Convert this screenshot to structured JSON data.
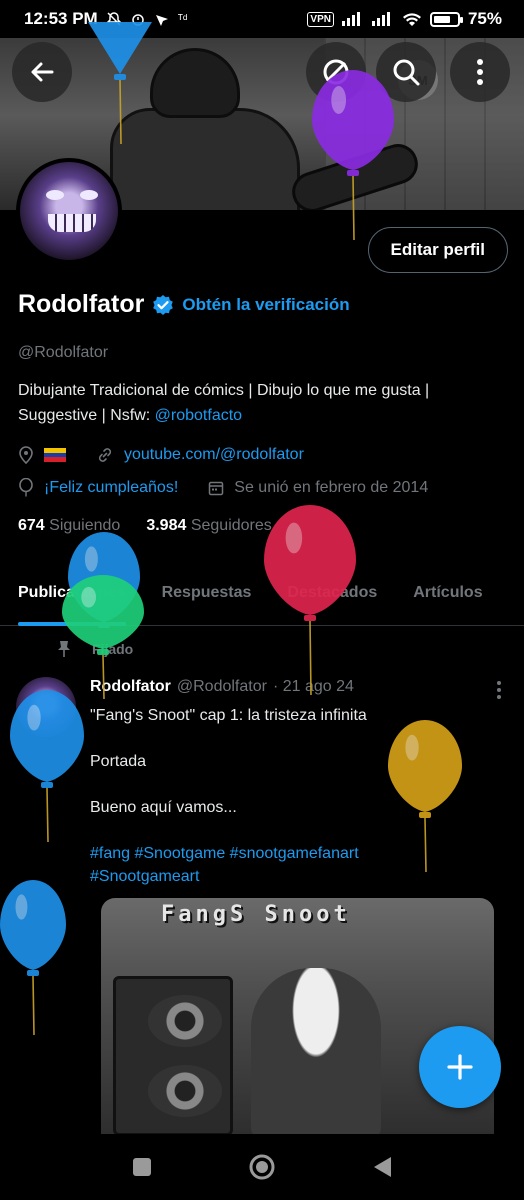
{
  "status_bar": {
    "time": "12:53 PM",
    "left_extra": "ᵀᵈ",
    "vpn": "VPN",
    "battery": "75%",
    "battery_level": 0.75
  },
  "header": {
    "back_icon": "arrow-left-icon",
    "action_icons": [
      "mask-icon",
      "search-icon",
      "more-vertical-icon"
    ],
    "banner_text": "SM"
  },
  "profile": {
    "edit_button": "Editar perfil",
    "name": "Rodolfator",
    "get_verified": "Obtén la verificación",
    "handle": "@Rodolfator",
    "bio_text": "Dibujante Tradicional de cómics | Dibujo lo que me gusta | Suggestive | Nsfw: ",
    "bio_mention": "@robotfacto",
    "link": "youtube.com/@rodolfator",
    "birthday": "¡Feliz cumpleaños!",
    "joined": "Se unió en febrero de 2014",
    "following_count": "674",
    "following_label": "Siguiendo",
    "followers_count": "3.984",
    "followers_label": "Seguidores",
    "accent": "#1d9bf0"
  },
  "tabs": [
    {
      "label": "Publicaciones",
      "active": true
    },
    {
      "label": "Respuestas",
      "active": false
    },
    {
      "label": "Destacados",
      "active": false
    },
    {
      "label": "Artículos",
      "active": false
    }
  ],
  "post": {
    "pinned_label": "Fijado",
    "author": "Rodolfator",
    "handle": "@Rodolfator",
    "date": "· 21 ago 24",
    "line1": "\"Fang's Snoot\" cap 1: la tristeza infinita",
    "line2": "Portada",
    "line3": "Bueno aquí vamos...",
    "tags_line1": "#fang #Snootgame #snootgamefanart",
    "tags_line2": "#Snootgameart",
    "image_title": "FangS Snoot"
  },
  "fab": {
    "icon": "plus-icon"
  },
  "nav": {
    "icons": [
      "recents-square-icon",
      "home-circle-icon",
      "back-triangle-icon"
    ]
  },
  "balloon_colors": [
    "#1e90e8",
    "#8a2be2",
    "#1e90e8",
    "#1fcf7a",
    "#e0244e",
    "#d4a017"
  ]
}
